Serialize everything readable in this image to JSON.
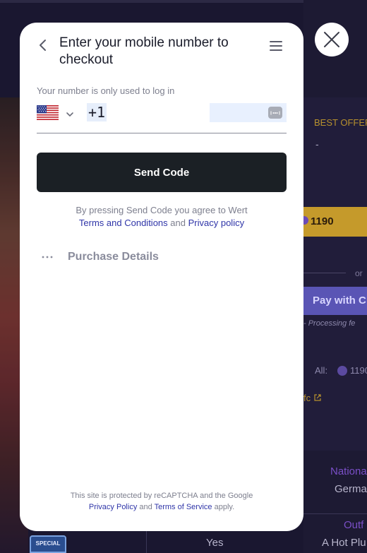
{
  "background": {
    "best_offer_label": "BEST OFFER",
    "best_offer_value": "-",
    "price": "1190",
    "or_label": "or",
    "pay_button": "Pay with C",
    "processing_fee": "- Processing fe",
    "all_label": "All:",
    "all_value": "1190",
    "link_fragment": "fc",
    "nationality_label": "Nationa",
    "nationality_value": "Germa",
    "outfit_label": "Outf",
    "outfit_value": "A Hot Plu",
    "yes_value": "Yes",
    "special_badge": "SPECIAL"
  },
  "modal": {
    "title": "Enter your mobile number to checkout",
    "hint": "Your number is only used to log in",
    "country_code": "+1",
    "phone_value": "",
    "send_button": "Send Code",
    "terms_prefix": "By pressing Send Code you agree to Wert",
    "terms_link": "Terms and Conditions",
    "terms_and": "and",
    "privacy_link": "Privacy policy",
    "purchase_details": "Purchase Details",
    "recaptcha_prefix": "This site is protected by reCAPTCHA and the Google",
    "recaptcha_privacy": "Privacy Policy",
    "recaptcha_and": "and",
    "recaptcha_tos": "Terms of Service",
    "recaptcha_suffix": "apply."
  },
  "icons": {
    "back": "chevron-left-icon",
    "menu": "hamburger-menu-icon",
    "close": "close-icon",
    "flag": "us-flag-icon",
    "dropdown": "chevron-down-icon",
    "autofill": "autofill-icon",
    "details": "more-dots-icon"
  },
  "colors": {
    "send_button_bg": "#1b2025",
    "link": "#2f35a8",
    "gold": "#c59a2b",
    "purple": "#5a55b5"
  }
}
